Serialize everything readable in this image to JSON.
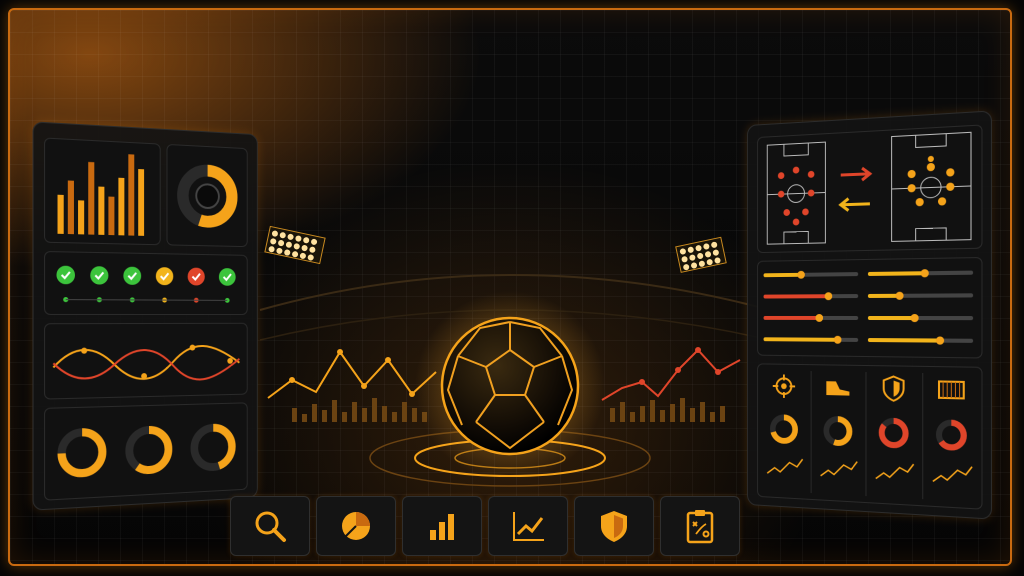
{
  "colors": {
    "accent": "#f5a31a",
    "accent_dark": "#c96a10",
    "red": "#e0452a",
    "green": "#3cc43c",
    "yellow": "#f2b41b",
    "background": "#050505"
  },
  "left_panel": {
    "bar_chart_values": [
      40,
      55,
      35,
      75,
      50,
      40,
      60,
      85,
      70
    ],
    "ring_fraction": 0.55,
    "status_checks": [
      "check-green",
      "check-green",
      "check-green",
      "check-yellow",
      "check-red",
      "check-green"
    ],
    "gauges": [
      0.75,
      0.6,
      0.45
    ]
  },
  "right_panel": {
    "sliders_left": [
      0.4,
      0.7,
      0.6,
      0.8
    ],
    "sliders_right": [
      0.55,
      0.3,
      0.45,
      0.7
    ],
    "icons": [
      "target-icon",
      "boot-icon",
      "shield-icon",
      "goal-icon"
    ],
    "rings": [
      0.7,
      0.55,
      0.85,
      0.65
    ]
  },
  "toolbar": {
    "items": [
      "search-icon",
      "pie-chart-icon",
      "bar-chart-icon",
      "line-chart-icon",
      "shield-icon",
      "tactics-board-icon"
    ]
  }
}
